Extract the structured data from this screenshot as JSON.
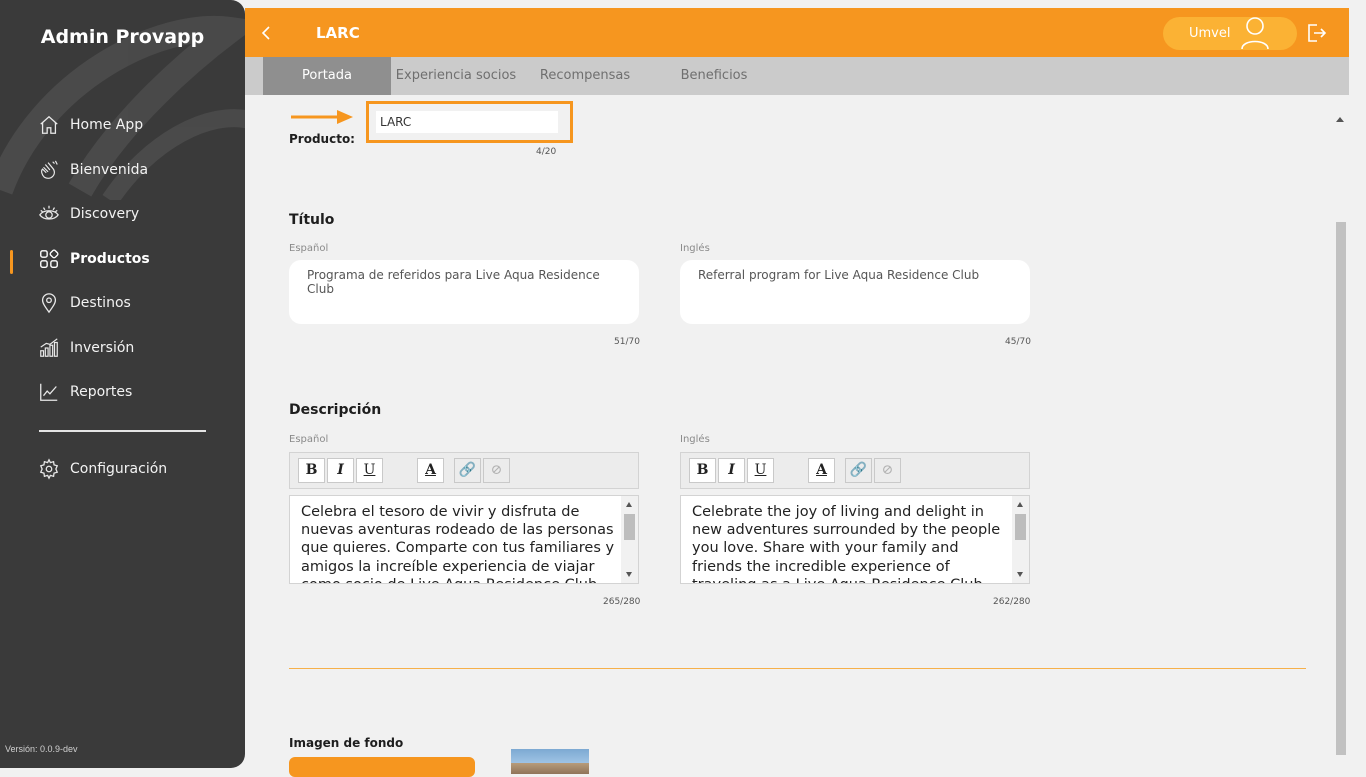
{
  "sidebar": {
    "brand": "Admin Provapp",
    "items": [
      {
        "label": "Home App",
        "icon": "home-icon"
      },
      {
        "label": "Bienvenida",
        "icon": "waving-hand-icon"
      },
      {
        "label": "Discovery",
        "icon": "eye-icon"
      },
      {
        "label": "Productos",
        "icon": "grid-icon",
        "active": true
      },
      {
        "label": "Destinos",
        "icon": "location-pin-icon"
      },
      {
        "label": "Inversión",
        "icon": "bar-chart-icon"
      },
      {
        "label": "Reportes",
        "icon": "line-chart-icon"
      }
    ],
    "config": {
      "label": "Configuración",
      "icon": "gear-icon"
    },
    "version": "Versión: 0.0.9-dev"
  },
  "topbar": {
    "title": "LARC",
    "user": "Umvel",
    "accent": "#f6961f"
  },
  "tabs": [
    {
      "label": "Portada",
      "active": true
    },
    {
      "label": "Experiencia socios"
    },
    {
      "label": "Recompensas"
    },
    {
      "label": "Beneficios"
    }
  ],
  "product": {
    "label": "Producto:",
    "value": "LARC",
    "counter": "4/20"
  },
  "titulo": {
    "heading": "Título",
    "es_label": "Español",
    "es_value": "Programa de referidos para Live Aqua Residence Club",
    "es_counter": "51/70",
    "en_label": "Inglés",
    "en_value": "Referral program for Live Aqua Residence Club",
    "en_counter": "45/70"
  },
  "descripcion": {
    "heading": "Descripción",
    "es_label": "Español",
    "es_value": "Celebra el tesoro de vivir y disfruta de nuevas aventuras rodeado de las personas que quieres. Comparte con tus familiares y amigos la increíble experiencia de viajar como socio de Live Aqua Residence Club",
    "es_counter": "265/280",
    "en_label": "Inglés",
    "en_value": "Celebrate the joy of living and delight in new adventures surrounded by the people you love. Share with your family and friends the incredible experience of traveling as a Live Aqua Residence Club",
    "en_counter": "262/280",
    "toolbar": {
      "bold": "B",
      "italic": "I",
      "underline": "U",
      "color": "A"
    }
  },
  "imagen": {
    "heading": "Imagen de fondo"
  }
}
